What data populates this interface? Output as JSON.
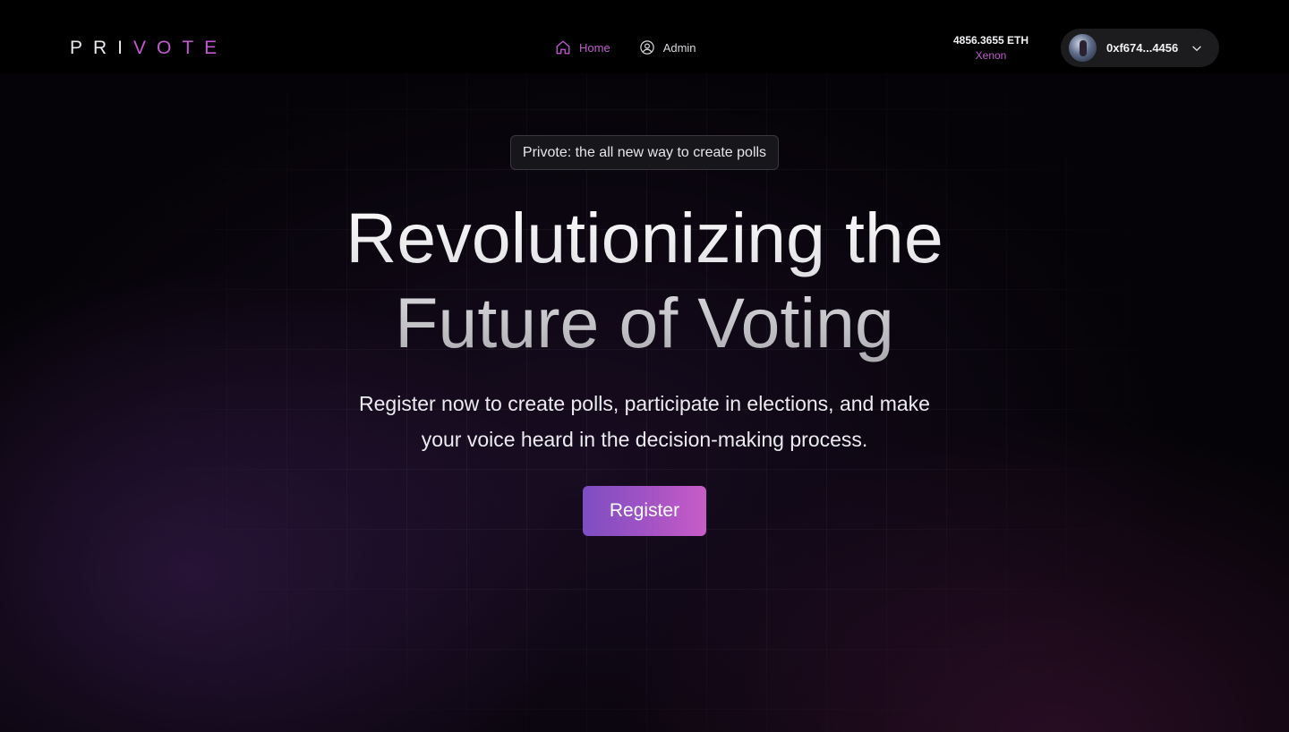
{
  "brand": {
    "logo_plain": "PRI",
    "logo_accent": "VOTE"
  },
  "nav": {
    "items": [
      {
        "label": "Home",
        "icon": "home-icon",
        "active": true
      },
      {
        "label": "Admin",
        "icon": "user-circle-icon",
        "active": false
      }
    ]
  },
  "wallet": {
    "balance": "4856.3655 ETH",
    "network": "Xenon",
    "address": "0xf674...4456",
    "avatar_icon": "avatar"
  },
  "hero": {
    "tagline": "Privote: the all new way to create polls",
    "headline_line1": "Revolutionizing the",
    "headline_line2": "Future of Voting",
    "subtitle_line1": "Register now to create polls, participate in elections, and make",
    "subtitle_line2": "your voice heard in the decision-making process.",
    "cta_label": "Register"
  },
  "colors": {
    "accent": "#c25ad0",
    "background": "#050307",
    "cta_gradient_start": "#7d4ec2",
    "cta_gradient_end": "#c85cc7"
  }
}
